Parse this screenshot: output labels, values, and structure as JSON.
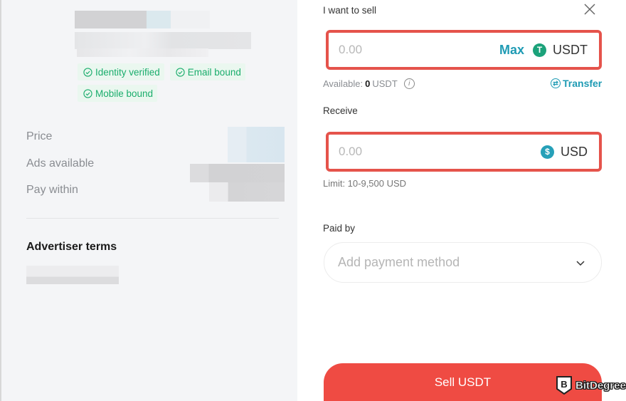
{
  "advertiser": {
    "badges": [
      {
        "label": "Identity verified",
        "icon": "check-circle-icon"
      },
      {
        "label": "Email bound",
        "icon": "check-circle-icon"
      },
      {
        "label": "Mobile bound",
        "icon": "check-circle-icon"
      }
    ],
    "info_labels": {
      "price": "Price",
      "ads_available": "Ads available",
      "pay_within": "Pay within"
    },
    "terms_title": "Advertiser terms"
  },
  "order": {
    "sell_label": "I want to sell",
    "sell_placeholder": "0.00",
    "max_label": "Max",
    "sell_currency": "USDT",
    "sell_coin_glyph": "T",
    "available_prefix": "Available:",
    "available_amount": "0",
    "available_currency": "USDT",
    "transfer_label": "Transfer",
    "receive_label": "Receive",
    "receive_placeholder": "0.00",
    "receive_currency": "USD",
    "receive_coin_glyph": "$",
    "limit_text": "Limit: 10-9,500 USD",
    "paid_by_label": "Paid by",
    "payment_placeholder": "Add payment method",
    "submit_label": "Sell USDT"
  },
  "watermark": {
    "label": "BitDegree"
  },
  "colors": {
    "accent": "#1f9bb4",
    "verified": "#1aad6c",
    "submit": "#ef4b43",
    "highlight": "#e5534b"
  }
}
